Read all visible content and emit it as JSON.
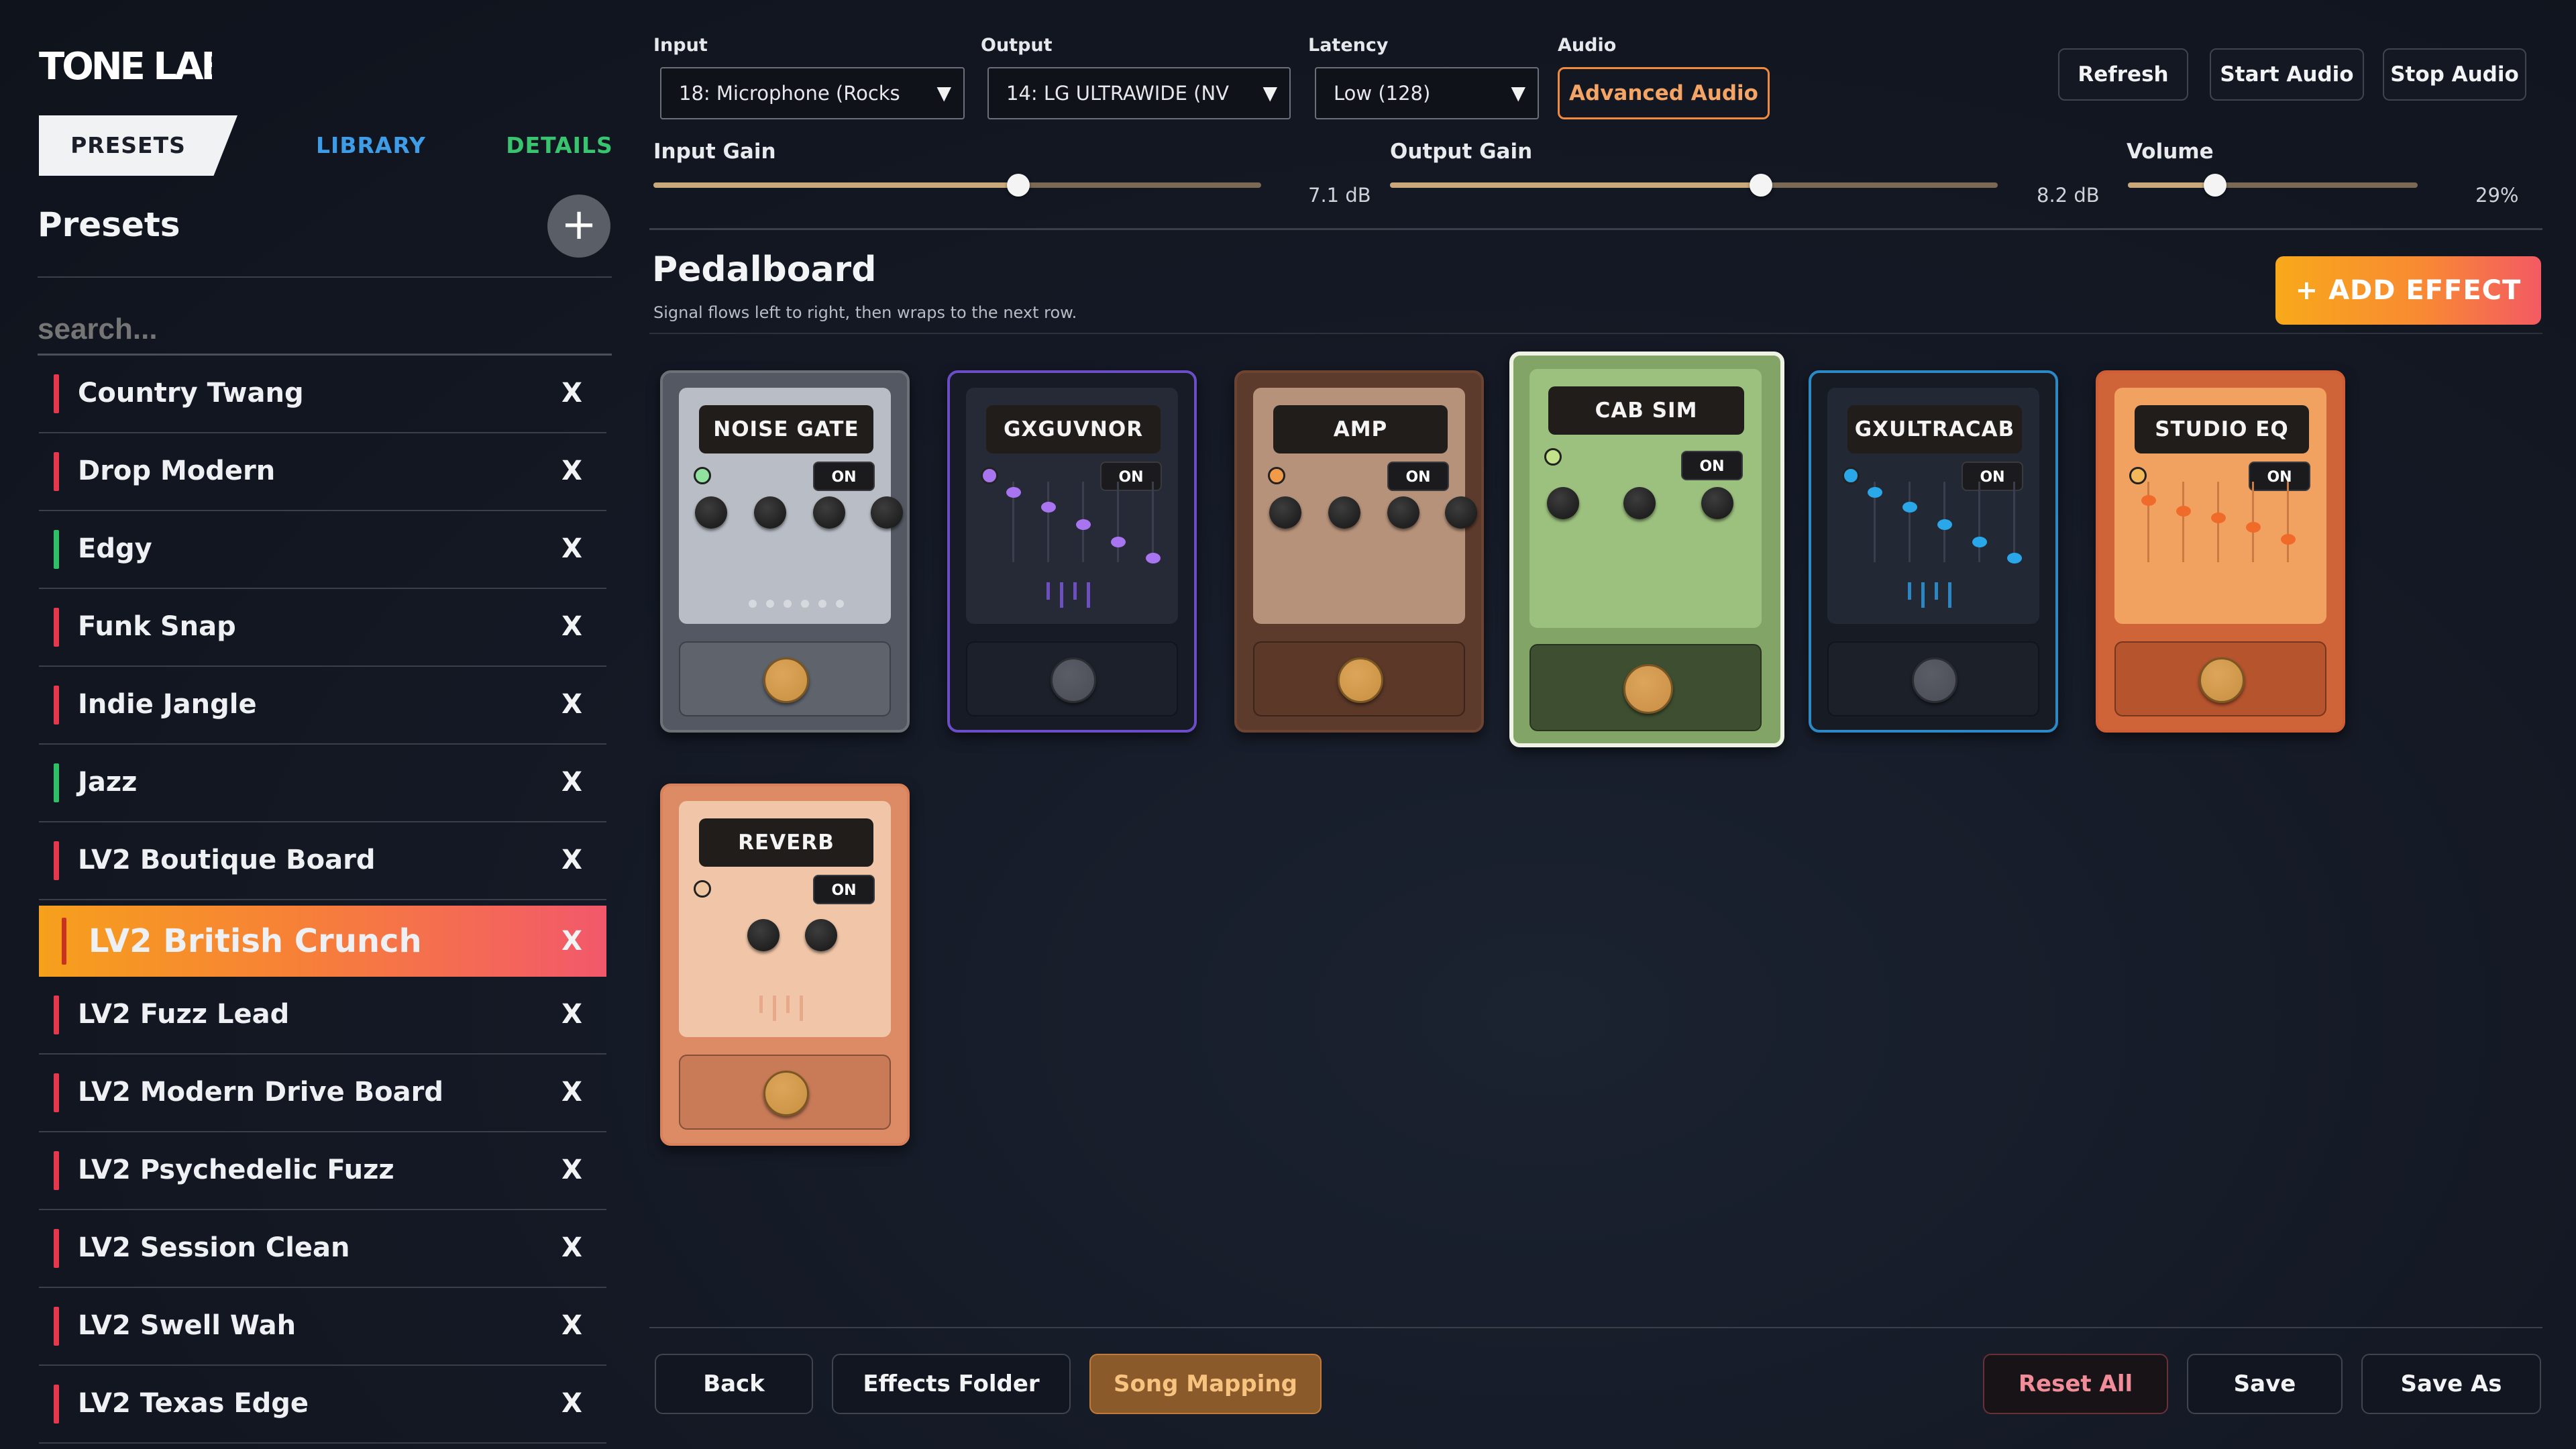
{
  "app": {
    "logo_text": "TONE LAB"
  },
  "sidebar": {
    "tabs": {
      "presets": "PRESETS",
      "library": "LIBRARY",
      "details": "DETAILS"
    },
    "title": "Presets",
    "add_icon": "plus-icon",
    "search_placeholder": "search...",
    "delete_label": "X",
    "presets": [
      {
        "name": "Country Twang",
        "color": "#e5384d"
      },
      {
        "name": "Drop Modern",
        "color": "#e5384d"
      },
      {
        "name": "Edgy",
        "color": "#2fbf66"
      },
      {
        "name": "Funk Snap",
        "color": "#e5384d"
      },
      {
        "name": "Indie Jangle",
        "color": "#e5384d"
      },
      {
        "name": "Jazz",
        "color": "#2fbf66"
      },
      {
        "name": "LV2 Boutique Board",
        "color": "#e5384d"
      },
      {
        "name": "LV2 British Crunch",
        "color": "#c8331f",
        "active": true
      },
      {
        "name": "LV2 Fuzz Lead",
        "color": "#e5384d"
      },
      {
        "name": "LV2 Modern Drive Board",
        "color": "#e5384d"
      },
      {
        "name": "LV2 Psychedelic Fuzz",
        "color": "#e5384d"
      },
      {
        "name": "LV2 Session Clean",
        "color": "#e5384d"
      },
      {
        "name": "LV2 Swell Wah",
        "color": "#e5384d"
      },
      {
        "name": "LV2 Texas Edge",
        "color": "#e5384d"
      }
    ]
  },
  "io": {
    "input_label": "Input",
    "input_value": "18: Microphone (Rocks",
    "output_label": "Output",
    "output_value": "14: LG ULTRAWIDE (NV",
    "latency_label": "Latency",
    "latency_value": "Low (128)",
    "audio_label": "Audio",
    "advanced_audio": "Advanced Audio",
    "refresh": "Refresh",
    "start_audio": "Start Audio",
    "stop_audio": "Stop Audio"
  },
  "sliders": {
    "input_gain": {
      "label": "Input Gain",
      "value": "7.1 dB",
      "level": 0.6
    },
    "output_gain": {
      "label": "Output Gain",
      "value": "8.2 dB",
      "level": 0.61
    },
    "volume": {
      "label": "Volume",
      "value": "29%",
      "level": 0.3
    }
  },
  "pedalboard": {
    "title": "Pedalboard",
    "subtitle": "Signal flows left to right, then wraps to the next row.",
    "add_effect": "+ ADD EFFECT",
    "on_label": "ON",
    "pedals": [
      {
        "name": "NOISE GATE",
        "theme": "#b9bec6",
        "led": "#8fe39d"
      },
      {
        "name": "GXGUVNOR",
        "theme": "#262a36",
        "led": "#a974f0"
      },
      {
        "name": "AMP",
        "theme": "#b6927a",
        "led": "#f19a47"
      },
      {
        "name": "CAB SIM",
        "theme": "#9cc17e",
        "led": "#c2e38a",
        "selected": true
      },
      {
        "name": "GXULTRACAB",
        "theme": "#222834",
        "led": "#2aa7e8"
      },
      {
        "name": "STUDIO EQ",
        "theme": "#f1a261",
        "led": "#f2b85a"
      },
      {
        "name": "REVERB",
        "theme": "#f1c6a8",
        "led": "#f0c6a0"
      }
    ]
  },
  "footer": {
    "back": "Back",
    "effects_folder": "Effects Folder",
    "song_mapping": "Song Mapping",
    "reset_all": "Reset All",
    "save": "Save",
    "save_as": "Save As"
  }
}
